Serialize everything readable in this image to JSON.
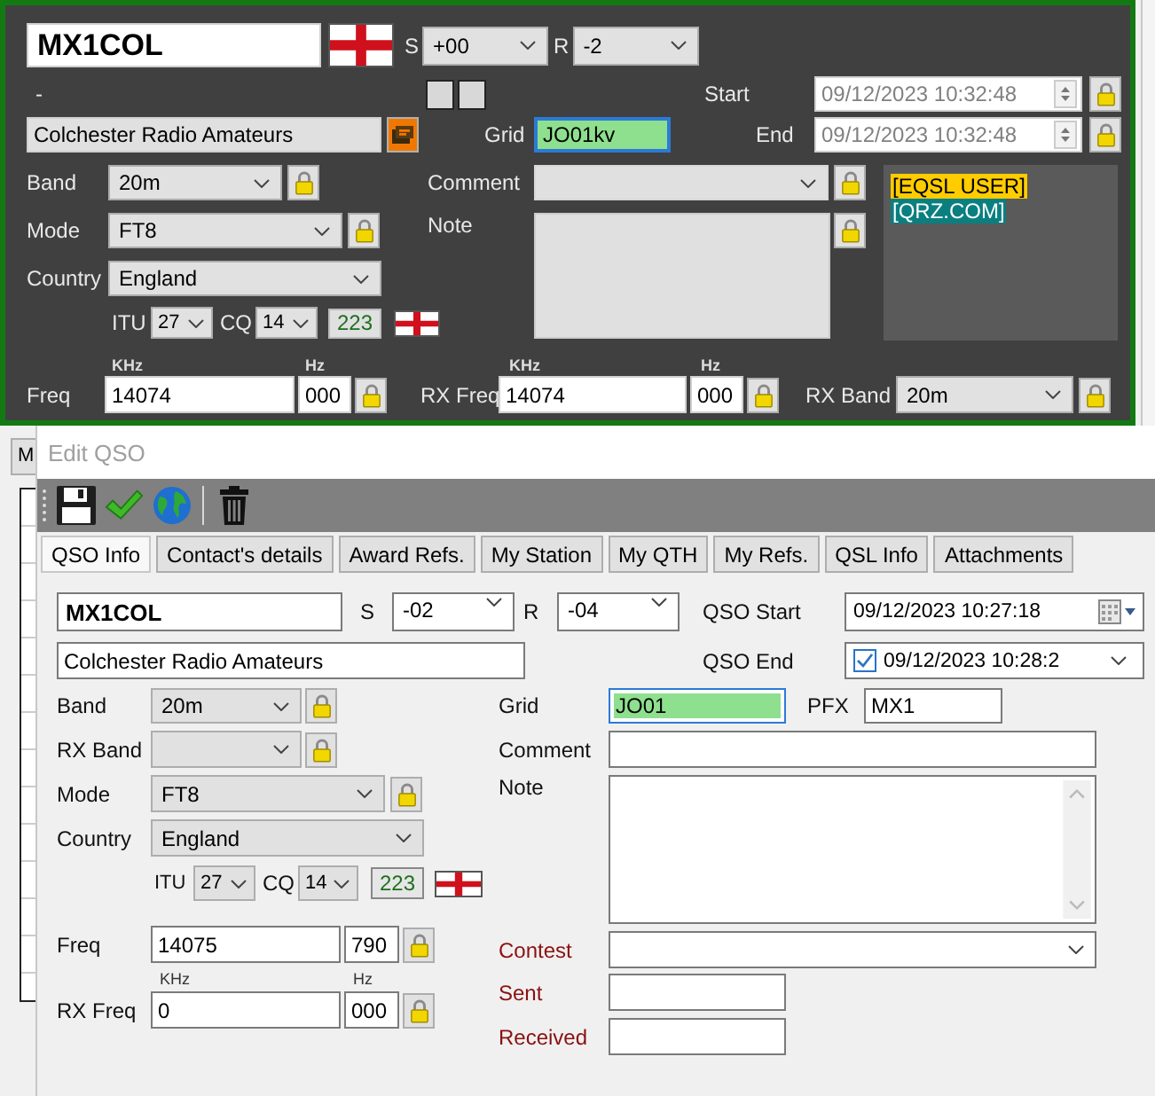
{
  "main_panel": {
    "callsign": "MX1COL",
    "s_label": "S",
    "s_value": "+00",
    "r_label": "R",
    "r_value": "-2",
    "dash": "-",
    "start_label": "Start",
    "start_value": "09/12/2023 10:32:48",
    "name": "Colchester Radio Amateurs",
    "grid_label": "Grid",
    "grid": {
      "value": "JO01kv",
      "focused": true
    },
    "end_label": "End",
    "end_value": "09/12/2023 10:32:48",
    "band_label": "Band",
    "band": "20m",
    "mode_label": "Mode",
    "mode": "FT8",
    "country_label": "Country",
    "country": "England",
    "itu_label": "ITU",
    "itu": "27",
    "cq_label": "CQ",
    "cq": "14",
    "zone": "223",
    "comment_label": "Comment",
    "note_label": "Note",
    "tags": [
      {
        "text": "[EQSL USER]",
        "color": "#ffcc00"
      },
      {
        "text": "[QRZ.COM]",
        "color": "#0a7f80"
      }
    ],
    "freq_unit": "KHz",
    "freq_hz_unit": "Hz",
    "rx_freq_unit": "KHz",
    "rx_freq_hz_unit": "Hz",
    "freq_label": "Freq",
    "freq": "14074",
    "freq_hz": "000",
    "rx_freq_label": "RX Freq",
    "rx_freq": "14074",
    "rx_freq_hz": "000",
    "rx_band_label": "RX Band",
    "rx_band": "20m"
  },
  "background_window": {
    "button": "M"
  },
  "edit_qso": {
    "title": "Edit QSO",
    "tabs": [
      {
        "label": "QSO Info",
        "selected": true
      },
      {
        "label": "Contact's details",
        "selected": false
      },
      {
        "label": "Award Refs.",
        "selected": false
      },
      {
        "label": "My Station",
        "selected": false
      },
      {
        "label": "My QTH",
        "selected": false
      },
      {
        "label": "My Refs.",
        "selected": false
      },
      {
        "label": "QSL Info",
        "selected": false
      },
      {
        "label": "Attachments",
        "selected": false
      }
    ],
    "callsign": "MX1COL",
    "s_label": "S",
    "s_value": "-02",
    "r_label": "R",
    "r_value": "-04",
    "qso_start_label": "QSO Start",
    "qso_start": "09/12/2023 10:27:18",
    "name": "Colchester Radio Amateurs",
    "qso_end_label": "QSO End",
    "qso_end": {
      "value": "09/12/2023 10:28:2",
      "checked": true
    },
    "band_label": "Band",
    "band": "20m",
    "rx_band_label": "RX Band",
    "mode_label": "Mode",
    "mode": "FT8",
    "country_label": "Country",
    "country": "England",
    "itu_label": "ITU",
    "itu": "27",
    "cq_label": "CQ",
    "cq": "14",
    "zone": "223",
    "freq_label": "Freq",
    "freq": "14075",
    "freq_hz": "790",
    "freq_unit": "KHz",
    "freq_hz_unit": "Hz",
    "rx_freq_label": "RX Freq",
    "rx_freq": "0",
    "rx_freq_hz": "000",
    "grid_label": "Grid",
    "grid": {
      "value": "JO01",
      "focused": true
    },
    "pfx_label": "PFX",
    "pfx": "MX1",
    "comment_label": "Comment",
    "note_label": "Note",
    "contest_label": "Contest",
    "sent_label": "Sent",
    "received_label": "Received"
  }
}
